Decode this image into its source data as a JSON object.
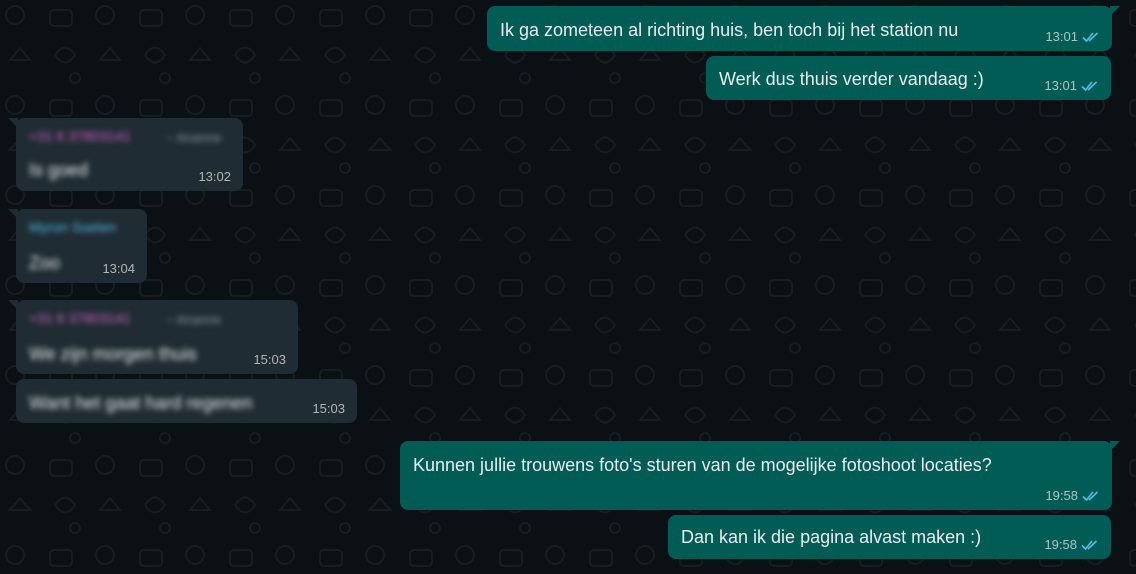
{
  "colors": {
    "outgoing_bubble": "#005c55",
    "incoming_bubble": "#1f2c33",
    "background": "#0b1014",
    "read_check": "#53bdeb",
    "sender_pink": "#d662c8",
    "sender_blue": "#53bdeb"
  },
  "messages": [
    {
      "direction": "outgoing",
      "text": "Ik ga zometeen al richting huis, ben toch bij het station nu",
      "time": "13:01",
      "status": "read"
    },
    {
      "direction": "outgoing",
      "text": "Werk dus thuis verder vandaag :)",
      "time": "13:01",
      "status": "read"
    },
    {
      "direction": "incoming",
      "sender": "+31 6 37803141",
      "sender_phone": "~ Ananne",
      "text": "Is goed",
      "time": "13:02",
      "blurred": true
    },
    {
      "direction": "incoming",
      "sender": "Myron Soeten",
      "text": "Zoo",
      "time": "13:04",
      "blurred": true
    },
    {
      "direction": "incoming",
      "sender": "+31 6 37803141",
      "sender_phone": "~ Ananne",
      "text": "We zijn morgen thuis",
      "time": "15:03",
      "blurred": true
    },
    {
      "direction": "incoming",
      "text": "Want het gaat hard regenen",
      "time": "15:03",
      "blurred": true
    },
    {
      "direction": "outgoing",
      "text": "Kunnen jullie trouwens foto's sturen van de mogelijke fotoshoot locaties?",
      "time": "19:58",
      "status": "read"
    },
    {
      "direction": "outgoing",
      "text": "Dan kan ik die pagina alvast maken :)",
      "time": "19:58",
      "status": "read"
    }
  ]
}
